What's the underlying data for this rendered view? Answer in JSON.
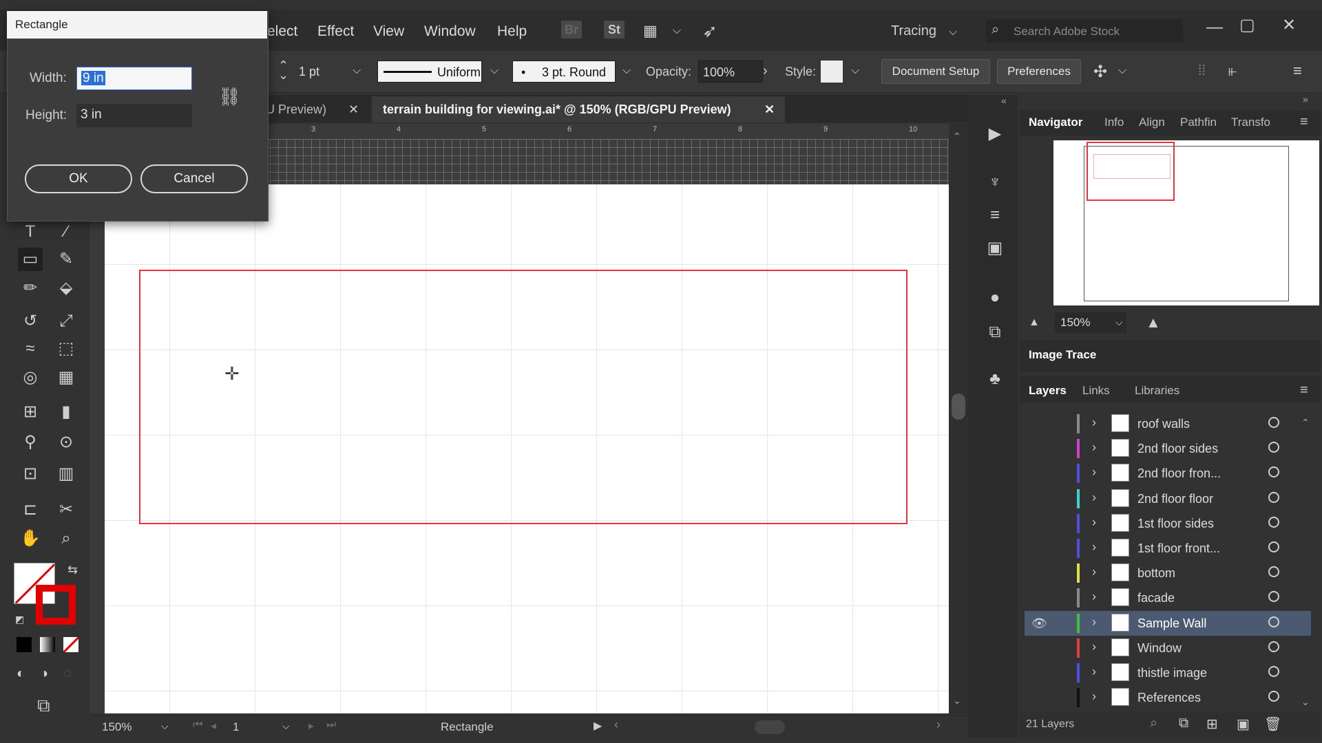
{
  "dialog": {
    "title": "Rectangle",
    "width_label": "Width:",
    "width_value": "9 in",
    "height_label": "Height:",
    "height_value": "3 in",
    "ok_label": "OK",
    "cancel_label": "Cancel"
  },
  "menubar": {
    "items": [
      "elect",
      "Effect",
      "View",
      "Window",
      "Help"
    ],
    "bridge_label": "Br",
    "stock_label": "St",
    "workspace_label": "Tracing",
    "search_placeholder": "Search Adobe Stock"
  },
  "controlbar": {
    "stroke_weight": "1 pt",
    "stroke_profile": "Uniform",
    "brush": "3 pt. Round",
    "opacity_label": "Opacity:",
    "opacity_value": "100%",
    "style_label": "Style:",
    "document_setup_label": "Document Setup",
    "preferences_label": "Preferences"
  },
  "tabs": [
    {
      "label": "U Preview)"
    },
    {
      "label": "terrain building for viewing.ai* @ 150% (RGB/GPU Preview)"
    }
  ],
  "ruler": {
    "ticks": [
      "3",
      "4",
      "5",
      "6",
      "7",
      "8",
      "9",
      "10"
    ]
  },
  "statusbar": {
    "zoom": "150%",
    "page": "1",
    "tool": "Rectangle"
  },
  "navigator_panel": {
    "tabs": [
      "Navigator",
      "Info",
      "Align",
      "Pathfin",
      "Transfo"
    ],
    "zoom": "150%"
  },
  "image_trace_label": "Image Trace",
  "layers_panel": {
    "tabs": [
      "Layers",
      "Links",
      "Libraries"
    ],
    "layers": [
      {
        "name": "roof walls",
        "color": "#8a8a8a",
        "visible": false,
        "selected": false
      },
      {
        "name": "2nd floor sides",
        "color": "#d040d0",
        "visible": false,
        "selected": false
      },
      {
        "name": "2nd floor fron...",
        "color": "#5050e0",
        "visible": false,
        "selected": false
      },
      {
        "name": "2nd floor floor",
        "color": "#40d0d0",
        "visible": false,
        "selected": false
      },
      {
        "name": "1st floor sides",
        "color": "#5050e0",
        "visible": false,
        "selected": false
      },
      {
        "name": "1st floor front...",
        "color": "#5050e0",
        "visible": false,
        "selected": false
      },
      {
        "name": "bottom",
        "color": "#e0e040",
        "visible": false,
        "selected": false
      },
      {
        "name": "facade",
        "color": "#8a8a8a",
        "visible": false,
        "selected": false
      },
      {
        "name": "Sample Wall",
        "color": "#40c040",
        "visible": true,
        "selected": true
      },
      {
        "name": "Window",
        "color": "#e04040",
        "visible": false,
        "selected": false
      },
      {
        "name": "thistle image",
        "color": "#5050e0",
        "visible": false,
        "selected": false
      },
      {
        "name": "References",
        "color": "#111111",
        "visible": false,
        "selected": false
      }
    ],
    "count_label": "21 Layers"
  },
  "colors": {
    "selection_red": "#e8323c",
    "layer_selected_bg": "#4b5a70",
    "stroke_fill": "#e00000"
  }
}
